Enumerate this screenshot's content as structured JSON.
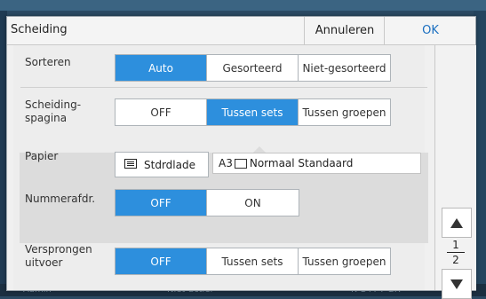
{
  "dialog": {
    "title": "Scheiding",
    "cancel_label": "Annuleren",
    "ok_label": "OK"
  },
  "sorteren": {
    "label": "Sorteren",
    "options": [
      "Auto",
      "Gesorteerd",
      "Niet-gesorteerd"
    ],
    "selected": "Auto"
  },
  "scheidingspagina": {
    "label_line1": "Scheiding-",
    "label_line2": "spagina",
    "options": [
      "OFF",
      "Tussen sets",
      "Tussen groepen"
    ],
    "selected": "Tussen sets"
  },
  "papier": {
    "label": "Papier",
    "tray_label": "Stdrdlade",
    "tray_icon": "tray-icon",
    "paper_size": "A3",
    "paper_icon": "landscape-paper-icon",
    "paper_value": "Normaal Standaard"
  },
  "nummerafdr": {
    "label": "Nummerafdr.",
    "options": [
      "OFF",
      "ON"
    ],
    "selected": "OFF"
  },
  "versprongen": {
    "label_line1": "Versprongen",
    "label_line2": "uitvoer",
    "options": [
      "OFF",
      "Tussen sets",
      "Tussen groepen"
    ],
    "selected": "OFF"
  },
  "scroll": {
    "page_current": "1",
    "page_total": "2",
    "up_icon": "arrow-up-icon",
    "down_icon": "arrow-down-icon"
  },
  "background": {
    "status_left": "Admin",
    "status_mid": "Niet-actief",
    "status_right": "K  C  M  Y  GR"
  },
  "colors": {
    "accent": "#2d8fdd",
    "ok_text": "#1a6fc0"
  }
}
